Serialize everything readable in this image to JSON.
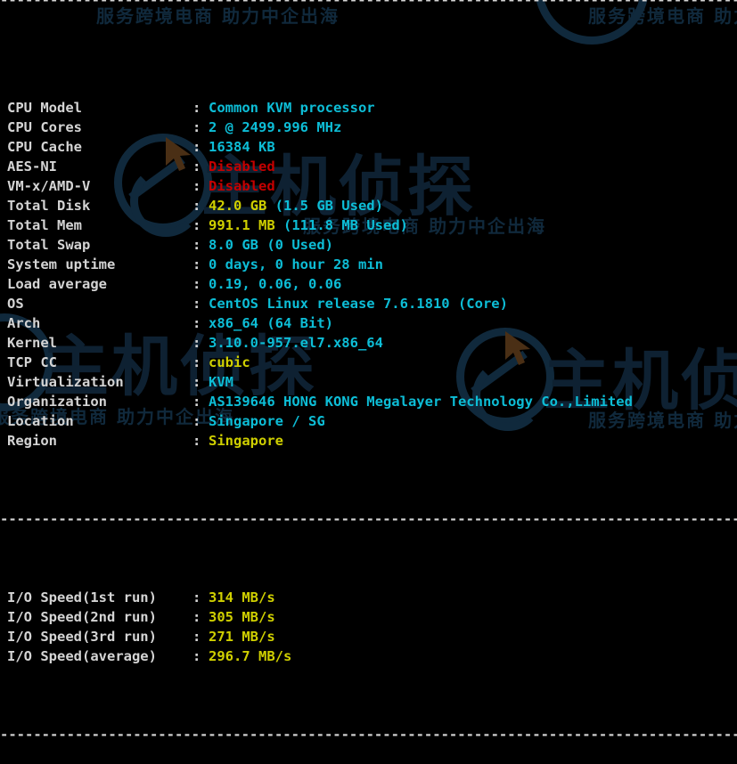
{
  "terminal": {
    "background_color": "#000000",
    "label_color": "#d4d4d4",
    "cyan_color": "#0dbdd6",
    "yellow_color": "#cfcf00",
    "red_color": "#c40000",
    "separator": "----------------------------------------------------------------------",
    "rows": [
      {
        "label": "CPU Model",
        "colon": ":",
        "segments": [
          {
            "text": "Common KVM processor",
            "color": "cyan"
          }
        ]
      },
      {
        "label": "CPU Cores",
        "colon": ":",
        "segments": [
          {
            "text": "2 @ 2499.996 MHz",
            "color": "cyan"
          }
        ]
      },
      {
        "label": "CPU Cache",
        "colon": ":",
        "segments": [
          {
            "text": "16384 KB",
            "color": "cyan"
          }
        ]
      },
      {
        "label": "AES-NI",
        "colon": ":",
        "segments": [
          {
            "text": "Disabled",
            "color": "red"
          }
        ]
      },
      {
        "label": "VM-x/AMD-V",
        "colon": ":",
        "segments": [
          {
            "text": "Disabled",
            "color": "red"
          }
        ]
      },
      {
        "label": "Total Disk",
        "colon": ":",
        "segments": [
          {
            "text": "42.0 GB ",
            "color": "yellow"
          },
          {
            "text": "(1.5 GB Used)",
            "color": "cyan"
          }
        ]
      },
      {
        "label": "Total Mem",
        "colon": ":",
        "segments": [
          {
            "text": "991.1 MB ",
            "color": "yellow"
          },
          {
            "text": "(111.8 MB Used)",
            "color": "cyan"
          }
        ]
      },
      {
        "label": "Total Swap",
        "colon": ":",
        "segments": [
          {
            "text": "8.0 GB (0 Used)",
            "color": "cyan"
          }
        ]
      },
      {
        "label": "System uptime",
        "colon": ":",
        "segments": [
          {
            "text": "0 days, 0 hour 28 min",
            "color": "cyan"
          }
        ]
      },
      {
        "label": "Load average",
        "colon": ":",
        "segments": [
          {
            "text": "0.19, 0.06, 0.06",
            "color": "cyan"
          }
        ]
      },
      {
        "label": "OS",
        "colon": ":",
        "segments": [
          {
            "text": "CentOS Linux release 7.6.1810 (Core)",
            "color": "cyan"
          }
        ]
      },
      {
        "label": "Arch",
        "colon": ":",
        "segments": [
          {
            "text": "x86_64 (64 Bit)",
            "color": "cyan"
          }
        ]
      },
      {
        "label": "Kernel",
        "colon": ":",
        "segments": [
          {
            "text": "3.10.0-957.el7.x86_64",
            "color": "cyan"
          }
        ]
      },
      {
        "label": "TCP CC",
        "colon": ":",
        "segments": [
          {
            "text": "cubic",
            "color": "yellow"
          }
        ]
      },
      {
        "label": "Virtualization",
        "colon": ":",
        "segments": [
          {
            "text": "KVM",
            "color": "cyan"
          }
        ]
      },
      {
        "label": "Organization",
        "colon": ":",
        "segments": [
          {
            "text": "AS139646 HONG KONG Megalayer Technology Co.,Limited",
            "color": "cyan"
          }
        ]
      },
      {
        "label": "Location",
        "colon": ":",
        "segments": [
          {
            "text": "Singapore / SG",
            "color": "cyan"
          }
        ]
      },
      {
        "label": "Region",
        "colon": ":",
        "segments": [
          {
            "text": "Singapore",
            "color": "yellow"
          }
        ]
      }
    ],
    "io_rows": [
      {
        "label": "I/O Speed(1st run)",
        "colon": ":",
        "segments": [
          {
            "text": "314 MB/s",
            "color": "yellow"
          }
        ]
      },
      {
        "label": "I/O Speed(2nd run)",
        "colon": ":",
        "segments": [
          {
            "text": "305 MB/s",
            "color": "yellow"
          }
        ]
      },
      {
        "label": "I/O Speed(3rd run)",
        "colon": ":",
        "segments": [
          {
            "text": "271 MB/s",
            "color": "yellow"
          }
        ]
      },
      {
        "label": "I/O Speed(average)",
        "colon": ":",
        "segments": [
          {
            "text": "296.7 MB/s",
            "color": "yellow"
          }
        ]
      }
    ]
  },
  "watermark": {
    "tagline": "服务跨境电商 助力中企出海",
    "brand": "主机侦探",
    "color": "#10293c"
  }
}
